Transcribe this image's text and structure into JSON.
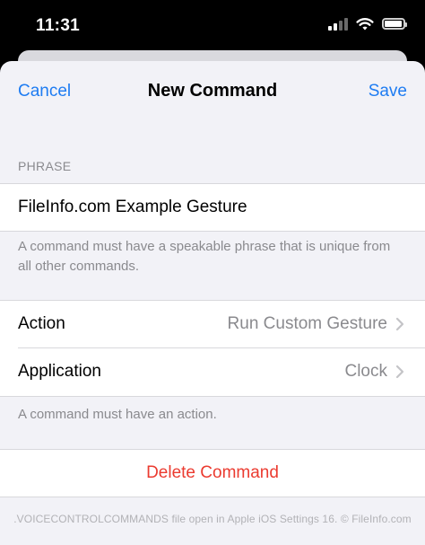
{
  "status_bar": {
    "time": "11:31"
  },
  "nav": {
    "cancel_label": "Cancel",
    "title": "New Command",
    "save_label": "Save"
  },
  "phrase_section": {
    "header": "PHRASE",
    "value": "FileInfo.com Example Gesture",
    "note": "A command must have a speakable phrase that is unique from all other commands."
  },
  "options": [
    {
      "label": "Action",
      "value": "Run Custom Gesture"
    },
    {
      "label": "Application",
      "value": "Clock"
    }
  ],
  "action_note": "A command must have an action.",
  "delete_label": "Delete Command",
  "credit": ".VOICECONTROLCOMMANDS file open in Apple iOS Settings 16. © FileInfo.com",
  "colors": {
    "accent": "#1e7cf2",
    "destructive": "#eb3b30",
    "secondary_text": "#8a8a8e",
    "grouped_bg": "#f2f2f7"
  },
  "icons": [
    "cellular-signal-icon",
    "wifi-icon",
    "battery-icon",
    "chevron-right-icon"
  ]
}
